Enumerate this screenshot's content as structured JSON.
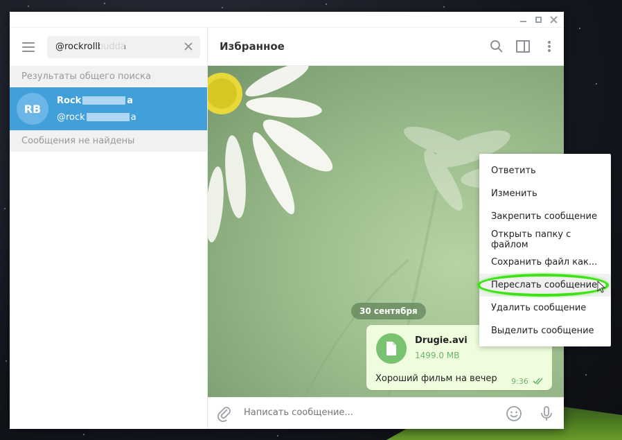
{
  "window": {
    "controls": [
      "minimize",
      "maximize",
      "close"
    ]
  },
  "sidebar": {
    "search": {
      "value": "@rockrollbudda"
    },
    "global_results_label": "Результаты общего поиска",
    "result": {
      "avatar_initials": "RB",
      "name": "Rock",
      "name_suffix": "a",
      "handle": "@rock",
      "handle_suffix": "a"
    },
    "messages_not_found": "Сообщения не найдены"
  },
  "chat": {
    "title": "Избранное",
    "date_separator": "30 сентября",
    "message": {
      "file_name": "Drugie.avi",
      "file_size": "1499.0 MB",
      "text": "Хороший фильм на вечер",
      "time": "9:36"
    },
    "composer_placeholder": "Написать сообщение..."
  },
  "context_menu": {
    "items": [
      "Ответить",
      "Изменить",
      "Закрепить сообщение",
      "Открыть папку с файлом",
      "Сохранить файл как...",
      "Переслать сообщение",
      "Удалить сообщение",
      "Выделить сообщение"
    ],
    "highlighted_index": 5
  },
  "colors": {
    "accent": "#419fd9",
    "bubble": "#effdde",
    "file_icon": "#78c272",
    "highlight": "#3ee316"
  }
}
